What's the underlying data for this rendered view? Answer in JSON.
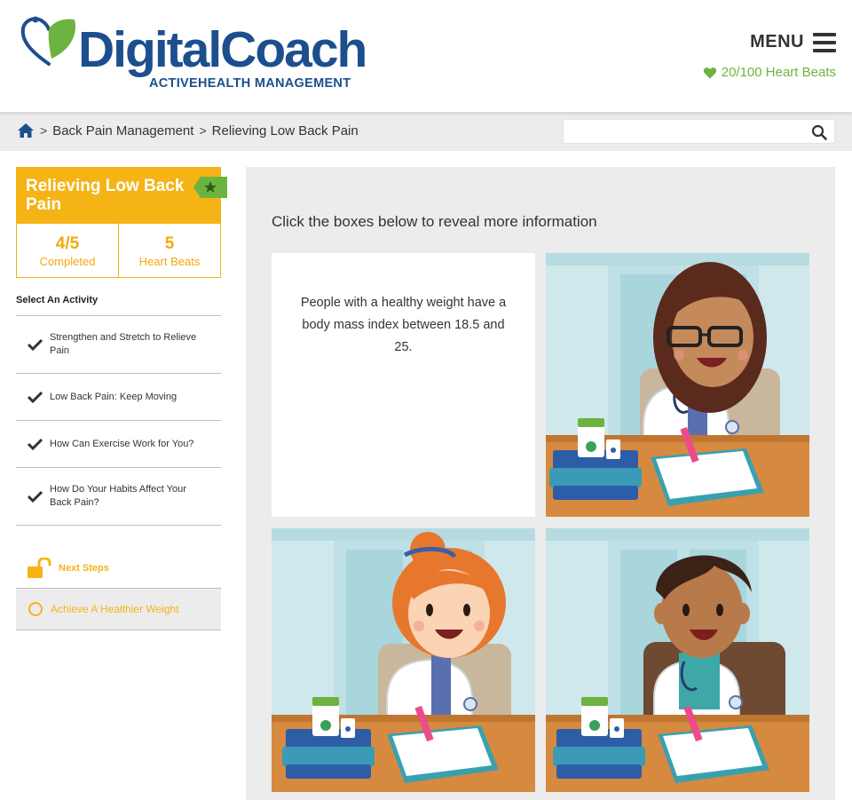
{
  "header": {
    "logo_text": "DigitalCoach",
    "logo_sub": "ACTIVEHEALTH MANAGEMENT",
    "menu_label": "MENU",
    "heart_beats": "20/100 Heart Beats",
    "brand_blue": "#1d4f8f",
    "brand_green": "#6db33f"
  },
  "breadcrumb": {
    "items": [
      "Back Pain Management",
      "Relieving Low Back Pain"
    ],
    "separator": ">"
  },
  "search": {
    "placeholder": ""
  },
  "sidebar": {
    "card_title": "Relieving Low Back Pain",
    "completed_value": "4/5",
    "completed_label": "Completed",
    "heart_beats_value": "5",
    "heart_beats_label": "Heart Beats",
    "accent": "#f5b316",
    "select_title": "Select An Activity",
    "activities": [
      {
        "label": "Strengthen and Stretch to Relieve Pain",
        "done": true
      },
      {
        "label": "Low Back Pain: Keep Moving",
        "done": true
      },
      {
        "label": "How Can Exercise Work for You?",
        "done": true
      },
      {
        "label": "How Do Your Habits Affect Your Back Pain?",
        "done": true
      }
    ],
    "next_steps_label": "Next Steps",
    "next_activity": "Achieve A Healthier Weight"
  },
  "main": {
    "instruction": "Click the boxes below to reveal more information",
    "revealed_text": "People with a healthy weight have a body mass index between 18.5 and 25.",
    "tiles": [
      {
        "state": "revealed"
      },
      {
        "state": "hidden",
        "illustration": "doctor-glasses"
      },
      {
        "state": "hidden",
        "illustration": "doctor-redhead"
      },
      {
        "state": "hidden",
        "illustration": "doctor-male"
      }
    ]
  }
}
